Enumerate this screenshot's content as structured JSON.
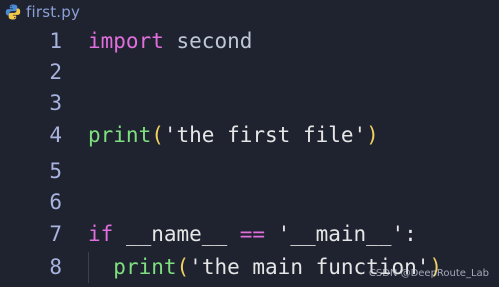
{
  "tab": {
    "filename": "first.py",
    "icon": "python-icon"
  },
  "colors": {
    "background": "#1f2330",
    "line_numbers": "#a8b4de",
    "keyword": "#e06edc",
    "function": "#7ee07e",
    "paren": "#f0d060",
    "string": "#e6e6e6",
    "identifier": "#bfc7d5"
  },
  "lines": [
    {
      "number": "1",
      "tokens": [
        {
          "t": "import",
          "c": "kw"
        },
        {
          "t": " ",
          "c": "plain"
        },
        {
          "t": "second",
          "c": "plain"
        }
      ]
    },
    {
      "number": "2",
      "tokens": []
    },
    {
      "number": "3",
      "tokens": []
    },
    {
      "number": "4",
      "tokens": [
        {
          "t": "print",
          "c": "fn"
        },
        {
          "t": "(",
          "c": "paren"
        },
        {
          "t": "'the first file'",
          "c": "str"
        },
        {
          "t": ")",
          "c": "paren"
        }
      ]
    },
    {
      "number": "5",
      "tokens": []
    },
    {
      "number": "6",
      "tokens": []
    },
    {
      "number": "7",
      "tokens": [
        {
          "t": "if",
          "c": "kw"
        },
        {
          "t": " __name__ ",
          "c": "str"
        },
        {
          "t": "==",
          "c": "op"
        },
        {
          "t": " '__main__'",
          "c": "str"
        },
        {
          "t": ":",
          "c": "str"
        }
      ]
    },
    {
      "number": "8",
      "tokens": [
        {
          "t": "  ",
          "c": "plain"
        },
        {
          "t": "print",
          "c": "fn"
        },
        {
          "t": "(",
          "c": "paren"
        },
        {
          "t": "'the main function'",
          "c": "str"
        },
        {
          "t": ")",
          "c": "paren"
        }
      ]
    }
  ],
  "watermark": "CSDN @DeepRoute_Lab"
}
